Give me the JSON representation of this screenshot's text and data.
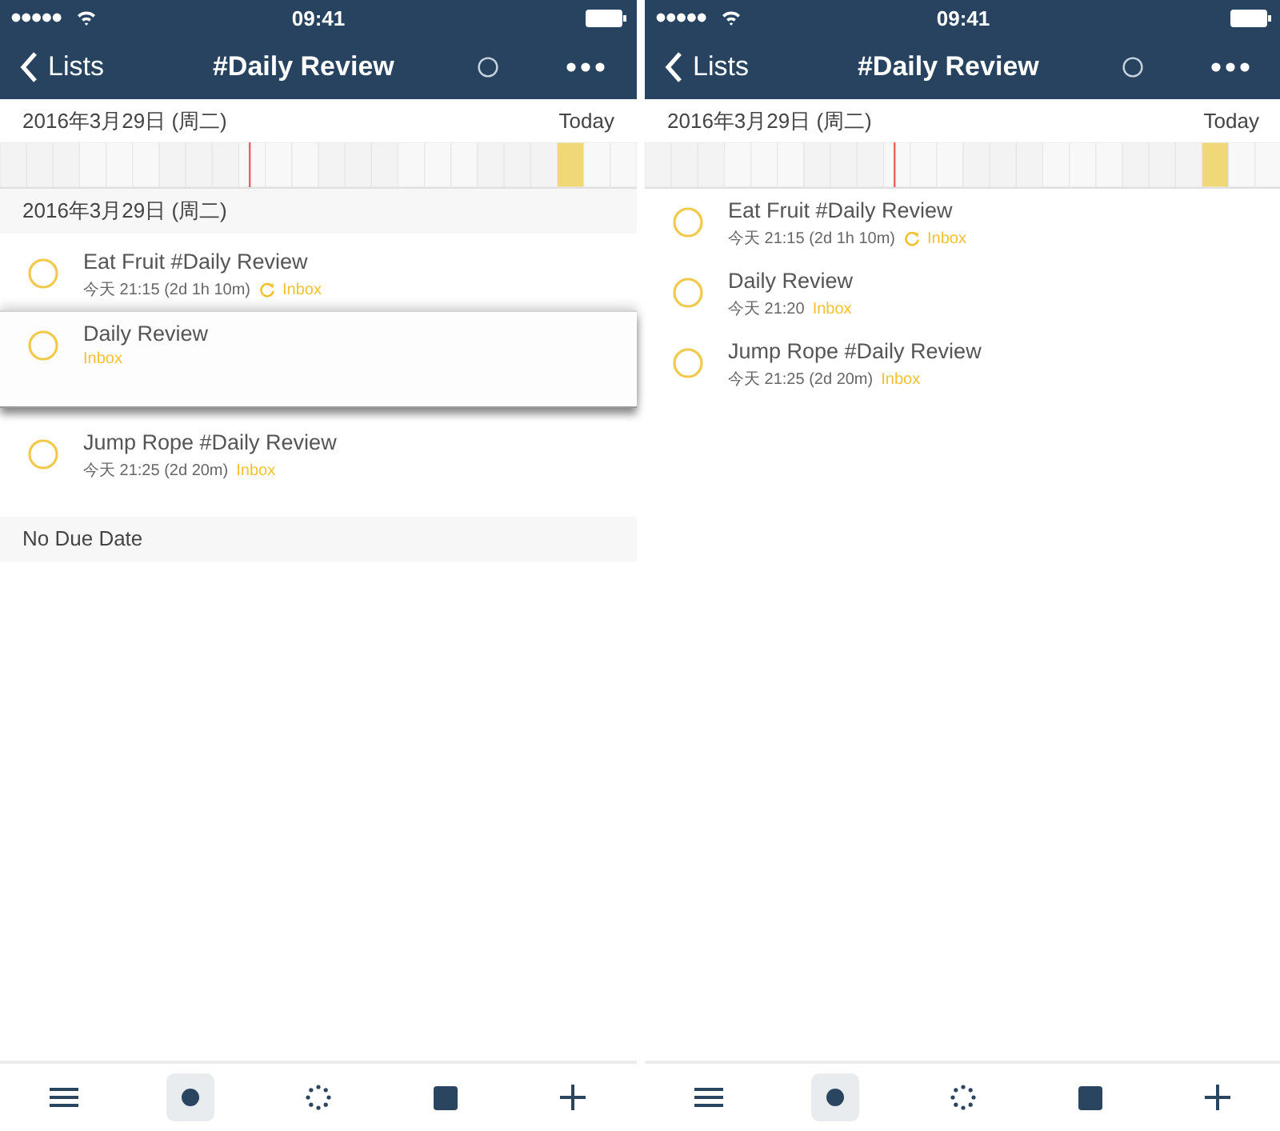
{
  "screens": [
    {
      "status_bar": {
        "time": "09:41"
      },
      "nav": {
        "back": "Lists",
        "title": "#Daily Review"
      },
      "date_bar": {
        "date": "2016年3月29日 (周二)",
        "today": "Today"
      },
      "sections": [
        {
          "header": "2016年3月29日 (周二)",
          "tasks": [
            {
              "title": "Eat Fruit #Daily Review",
              "time": "今天 21:15 (2d 1h 10m)",
              "repeat": true,
              "list": "Inbox",
              "lifted": false
            },
            {
              "title": "Daily Review",
              "repeat": false,
              "list": "Inbox",
              "lifted": true
            },
            {
              "title": "Jump Rope #Daily Review",
              "time": "今天 21:25 (2d 20m)",
              "repeat": false,
              "list": "Inbox",
              "lifted": false
            }
          ]
        },
        {
          "header": "No Due Date"
        }
      ],
      "tab_bar": [
        {
          "kind": "menu",
          "selected": false
        },
        {
          "kind": "dot",
          "selected": true
        },
        {
          "kind": "dots",
          "selected": false
        },
        {
          "kind": "square",
          "selected": false
        },
        {
          "kind": "plus",
          "selected": false
        }
      ]
    },
    {
      "status_bar": {
        "time": "09:41"
      },
      "nav": {
        "back": "Lists",
        "title": "#Daily Review"
      },
      "date_bar": {
        "date": "2016年3月29日 (周二)",
        "today": "Today"
      },
      "sections": [
        {
          "tasks": [
            {
              "title": "Eat Fruit #Daily Review",
              "time": "今天 21:15 (2d 1h 10m)",
              "repeat": true,
              "list": "Inbox",
              "lifted": false
            },
            {
              "title": "Daily Review",
              "time": "今天 21:20",
              "repeat": false,
              "list": "Inbox",
              "lifted": false
            },
            {
              "title": "Jump Rope #Daily Review",
              "time": "今天 21:25 (2d 20m)",
              "repeat": false,
              "list": "Inbox",
              "lifted": false
            }
          ]
        }
      ],
      "tab_bar": [
        {
          "kind": "menu",
          "selected": false
        },
        {
          "kind": "dot",
          "selected": true
        },
        {
          "kind": "dots",
          "selected": false
        },
        {
          "kind": "square",
          "selected": false
        },
        {
          "kind": "plus",
          "selected": false
        }
      ]
    }
  ]
}
